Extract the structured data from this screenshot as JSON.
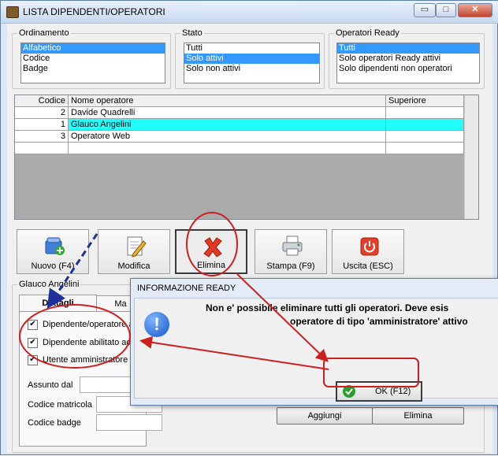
{
  "window": {
    "title": "LISTA DIPENDENTI/OPERATORI",
    "min_glyph": "▭",
    "max_glyph": "□",
    "close_glyph": "✕"
  },
  "ordinamento": {
    "title": "Ordinamento",
    "items": [
      "Alfabetico",
      "Codice",
      "Badge"
    ],
    "selected": "Alfabetico"
  },
  "stato": {
    "title": "Stato",
    "items": [
      "Tutti",
      "Solo attivi",
      "Solo non attivi"
    ],
    "selected": "Solo attivi"
  },
  "operatori_ready": {
    "title": "Operatori Ready",
    "items": [
      "Tutti",
      "Solo operatori Ready attivi",
      "Solo dipendenti non operatori"
    ],
    "selected": "Tutti"
  },
  "grid": {
    "columns": [
      "Codice",
      "Nome operatore",
      "Superiore"
    ],
    "rows": [
      {
        "codice": "2",
        "nome": "Davide Quadrelli",
        "superiore": ""
      },
      {
        "codice": "1",
        "nome": "Glauco Angelini",
        "superiore": ""
      },
      {
        "codice": "3",
        "nome": "Operatore Web",
        "superiore": ""
      }
    ],
    "selected_row": "Glauco Angelini",
    "selected_color": "#22ffff"
  },
  "toolbar": {
    "nuovo": "Nuovo (F4)",
    "modifica": "Modifica",
    "elimina": "Elimina",
    "stampa": "Stampa (F9)",
    "uscita": "Uscita (ESC)"
  },
  "details": {
    "group_title": "Glauco Angelini",
    "tab_dettagli": "Dettagli",
    "tab_second": "Ma",
    "check1": "Dipendente/operatore a",
    "check2": "Dipendente abilitato ad",
    "check3": "Utente amministratore",
    "assunto_label": "Assunto dal",
    "matricola_label": "Codice matricola",
    "badge_label": "Codice badge",
    "aggiungi": "Aggiungi",
    "elimina": "Elimina"
  },
  "dialog": {
    "title": "INFORMAZIONE READY",
    "line1": "Non e' possibile eliminare tutti gli operatori. Deve esis",
    "line2": "operatore di tipo 'amministratore' attivo",
    "ok": "OK (F12)"
  },
  "colors": {
    "annotation_red": "#cc1f1f",
    "annotation_blue": "#1f2f9c",
    "selection_blue": "#3399ff"
  },
  "icons": {
    "title": "app-icon",
    "nuovo": "add-user-icon",
    "modifica": "edit-document-icon",
    "elimina": "red-x-icon",
    "stampa": "printer-icon",
    "uscita": "power-icon",
    "dialog": "info-icon",
    "ok": "checkmark-icon"
  }
}
